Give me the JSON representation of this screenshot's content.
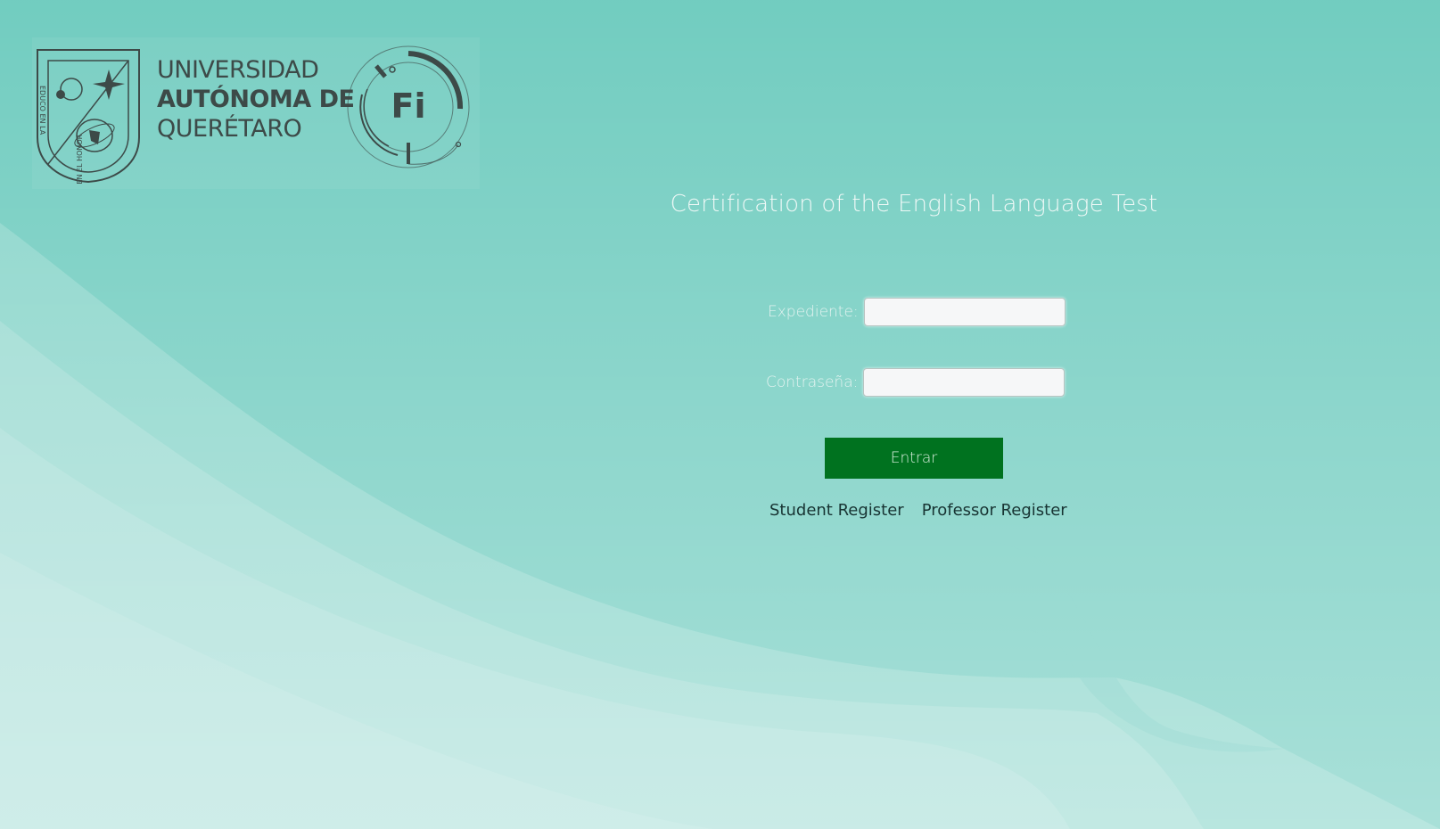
{
  "branding": {
    "university_line1": "UNIVERSIDAD",
    "university_line2": "AUTÓNOMA DE",
    "university_line3": "QUERÉTARO",
    "fi_logo_text": "Fi",
    "shield_icon": "uaq-shield-icon"
  },
  "header": {
    "title": "Certification of the English Language Test"
  },
  "login_form": {
    "expediente_label": "Expediente:",
    "expediente_value": "",
    "password_label": "Contraseña:",
    "password_value": "",
    "submit_label": "Entrar"
  },
  "links": {
    "student_register": "Student Register",
    "professor_register": "Professor Register"
  },
  "colors": {
    "background": "#62c7b9",
    "button": "#00721f",
    "logo_gray": "#3d4a48"
  }
}
